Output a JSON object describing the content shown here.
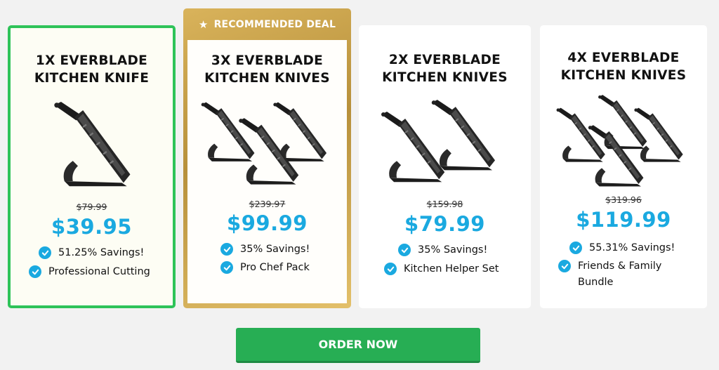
{
  "packages": [
    {
      "title_line1": "1X EVERBLADE",
      "title_line2": "KITCHEN KNIFE",
      "old_price": "$79.99",
      "price": "$39.95",
      "feature1": "51.25% Savings!",
      "feature2": "Professional Cutting",
      "knife_count": 1,
      "state": "selected"
    },
    {
      "badge": "RECOMMENDED DEAL",
      "title_line1": "3X EVERBLADE",
      "title_line2": "KITCHEN KNIVES",
      "old_price": "$239.97",
      "price": "$99.99",
      "feature1": "35% Savings!",
      "feature2": "Pro Chef Pack",
      "knife_count": 3
    },
    {
      "title_line1": "2X EVERBLADE",
      "title_line2": "KITCHEN KNIVES",
      "old_price": "$159.98",
      "price": "$79.99",
      "feature1": "35% Savings!",
      "feature2": "Kitchen Helper Set",
      "knife_count": 2
    },
    {
      "title_line1": "4X EVERBLADE",
      "title_line2": "KITCHEN KNIVES",
      "old_price": "$319.96",
      "price": "$119.99",
      "feature1": "55.31% Savings!",
      "feature2_line1": "Friends & Family",
      "feature2_line2": "Bundle",
      "knife_count": 4
    }
  ],
  "order_button": "ORDER NOW",
  "colors": {
    "accent_blue": "#1aa9e0",
    "selected_green": "#2ec359",
    "order_green": "#27ae54",
    "gold": "#c9a24b"
  }
}
